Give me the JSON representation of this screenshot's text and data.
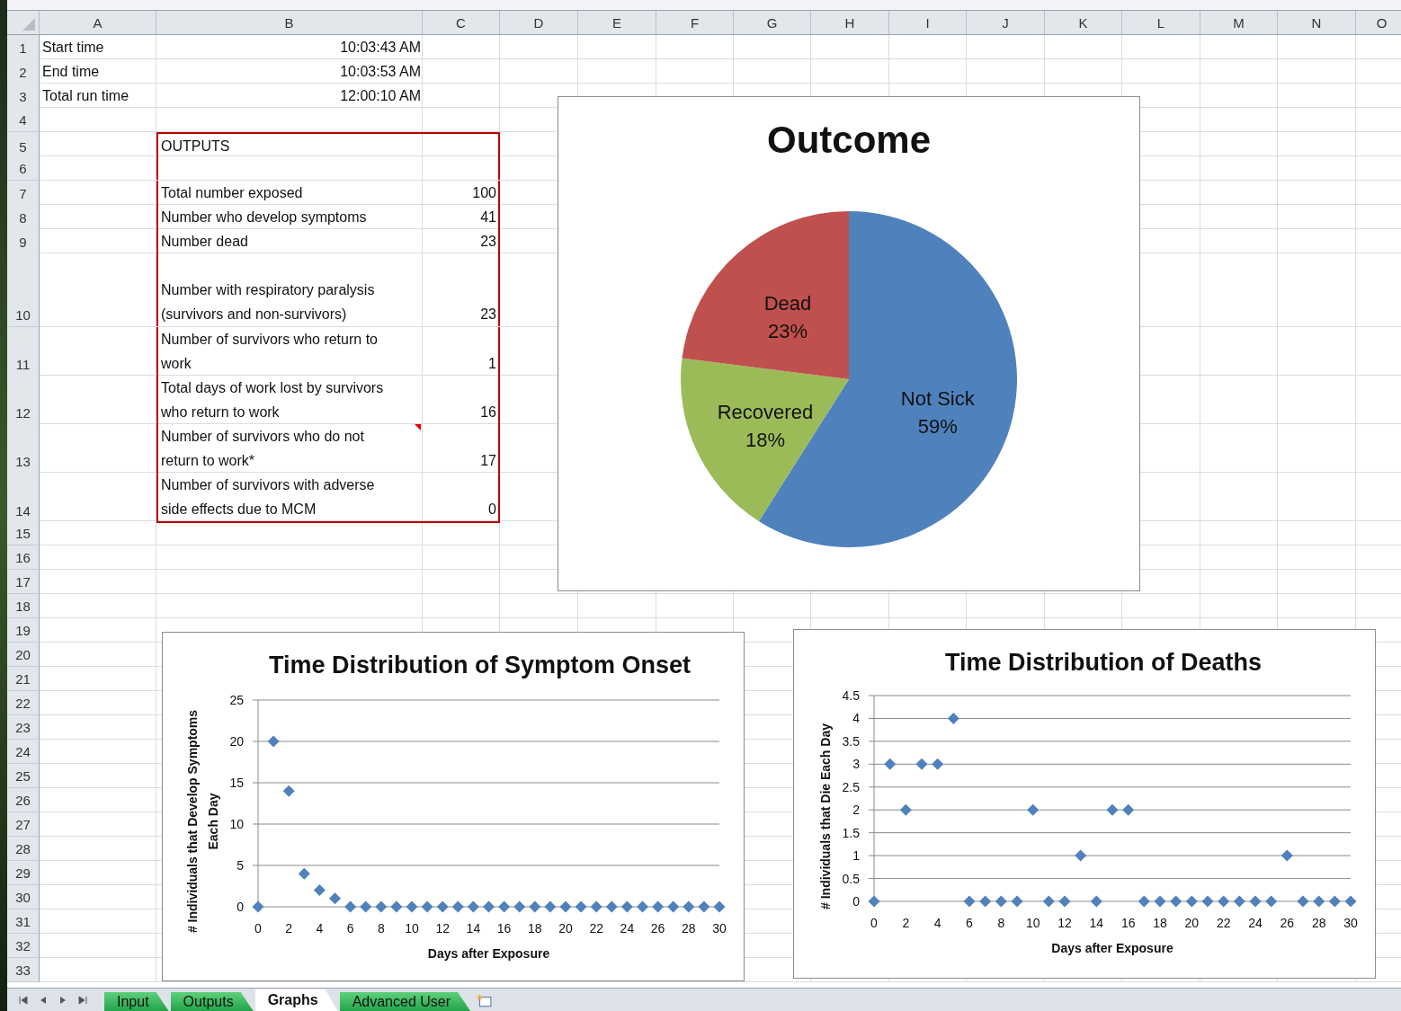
{
  "columns": [
    "A",
    "B",
    "C",
    "D",
    "E",
    "F",
    "G",
    "H",
    "I",
    "J",
    "K",
    "L",
    "M",
    "N",
    "O"
  ],
  "rows": [
    {
      "header": "1",
      "kind": "timing",
      "a": "Start time",
      "b": "10:03:43 AM",
      "boxed": false,
      "comment": false
    },
    {
      "header": "2",
      "kind": "timing",
      "a": "End time",
      "b": "10:03:53 AM",
      "boxed": false,
      "comment": false
    },
    {
      "header": "3",
      "kind": "timing",
      "a": "Total run time",
      "b": "12:00:10 AM",
      "boxed": false,
      "comment": false
    },
    {
      "header": "4",
      "kind": "blank",
      "boxed": false,
      "comment": false
    },
    {
      "header": "5",
      "kind": "output",
      "b": "OUTPUTS",
      "boxed": true,
      "comment": false
    },
    {
      "header": "6",
      "kind": "output",
      "boxed": true,
      "comment": false
    },
    {
      "header": "7",
      "kind": "output",
      "b": "Total number exposed",
      "c": "100",
      "boxed": true,
      "comment": false
    },
    {
      "header": "8",
      "kind": "output",
      "b": "Number who develop symptoms",
      "c": "41",
      "boxed": true,
      "comment": false
    },
    {
      "header": "9",
      "kind": "output",
      "b": "Number dead",
      "c": "23",
      "boxed": true,
      "comment": false
    },
    {
      "header": "10",
      "kind": "output",
      "b": "Number with respiratory paralysis (survivors and non-survivors)",
      "c": "23",
      "boxed": true,
      "comment": false
    },
    {
      "header": "11",
      "kind": "output",
      "b": "Number of survivors who return to work",
      "c": "1",
      "boxed": true,
      "comment": false
    },
    {
      "header": "12",
      "kind": "output",
      "b": "Total days of work lost by survivors who return to work",
      "c": "16",
      "boxed": true,
      "comment": false
    },
    {
      "header": "13",
      "kind": "output",
      "b": "Number of survivors who do not return to work*",
      "c": "17",
      "boxed": true,
      "comment": true
    },
    {
      "header": "14",
      "kind": "output",
      "b": "Number of survivors with adverse side effects due to MCM",
      "c": "0",
      "boxed": true,
      "comment": false
    },
    {
      "header": "15",
      "kind": "blank",
      "boxed": false,
      "comment": false
    },
    {
      "header": "16",
      "kind": "blank",
      "boxed": false,
      "comment": false
    },
    {
      "header": "17",
      "kind": "blank",
      "boxed": false,
      "comment": false
    },
    {
      "header": "18",
      "kind": "blank",
      "boxed": false,
      "comment": false
    },
    {
      "header": "19",
      "kind": "blank",
      "boxed": false,
      "comment": false
    },
    {
      "header": "20",
      "kind": "blank",
      "boxed": false,
      "comment": false
    },
    {
      "header": "21",
      "kind": "blank",
      "boxed": false,
      "comment": false
    },
    {
      "header": "22",
      "kind": "blank",
      "boxed": false,
      "comment": false
    },
    {
      "header": "23",
      "kind": "blank",
      "boxed": false,
      "comment": false
    },
    {
      "header": "24",
      "kind": "blank",
      "boxed": false,
      "comment": false
    },
    {
      "header": "25",
      "kind": "blank",
      "boxed": false,
      "comment": false
    },
    {
      "header": "26",
      "kind": "blank",
      "boxed": false,
      "comment": false
    },
    {
      "header": "27",
      "kind": "blank",
      "boxed": false,
      "comment": false
    },
    {
      "header": "28",
      "kind": "blank",
      "boxed": false,
      "comment": false
    },
    {
      "header": "29",
      "kind": "blank",
      "boxed": false,
      "comment": false
    },
    {
      "header": "30",
      "kind": "blank",
      "boxed": false,
      "comment": false
    },
    {
      "header": "31",
      "kind": "blank",
      "boxed": false,
      "comment": false
    },
    {
      "header": "32",
      "kind": "blank",
      "boxed": false,
      "comment": false
    },
    {
      "header": "33",
      "kind": "blank",
      "boxed": false,
      "comment": false
    }
  ],
  "charts": [
    {
      "chart_data": {
        "type": "pie",
        "title": "Outcome",
        "categories": [
          "Not Sick",
          "Recovered",
          "Dead"
        ],
        "values": [
          59,
          18,
          23
        ],
        "colors": [
          "#4f81bd",
          "#9bbb59",
          "#c0504d"
        ],
        "data_labels": true,
        "value_labels": [
          "59%",
          "18%",
          "23%"
        ]
      }
    },
    {
      "chart_data": {
        "type": "scatter",
        "title": "Time Distribution of Symptom Onset",
        "xlabel": "Days after Exposure",
        "ylabel": "# Individuals that Develop Symptoms Each Day",
        "x": [
          0,
          1,
          2,
          3,
          4,
          5,
          6,
          7,
          8,
          9,
          10,
          11,
          12,
          13,
          14,
          15,
          16,
          17,
          18,
          19,
          20,
          21,
          22,
          23,
          24,
          25,
          26,
          27,
          28,
          29,
          30
        ],
        "series": [
          {
            "color": "#4f81bd",
            "values": [
              0,
              20,
              14,
              4,
              2,
              1,
              0,
              0,
              0,
              0,
              0,
              0,
              0,
              0,
              0,
              0,
              0,
              0,
              0,
              0,
              0,
              0,
              0,
              0,
              0,
              0,
              0,
              0,
              0,
              0,
              0
            ]
          }
        ],
        "grid": true,
        "xlim": [
          0,
          30
        ],
        "ylim": [
          0,
          25
        ],
        "xticks": [
          0,
          2,
          4,
          6,
          8,
          10,
          12,
          14,
          16,
          18,
          20,
          22,
          24,
          26,
          28,
          30
        ],
        "yticks": [
          0,
          5,
          10,
          15,
          20,
          25
        ]
      }
    },
    {
      "chart_data": {
        "type": "scatter",
        "title": "Time Distribution of Deaths",
        "xlabel": "Days after Exposure",
        "ylabel": "# Individuals that Die Each Day",
        "x": [
          0,
          1,
          2,
          3,
          4,
          5,
          6,
          7,
          8,
          9,
          10,
          11,
          12,
          13,
          14,
          15,
          16,
          17,
          18,
          19,
          20,
          21,
          22,
          23,
          24,
          25,
          26,
          27,
          28,
          29,
          30
        ],
        "series": [
          {
            "color": "#4f81bd",
            "values": [
              0,
              3,
              2,
              3,
              3,
              4,
              0,
              0,
              0,
              0,
              2,
              0,
              0,
              1,
              0,
              2,
              2,
              0,
              0,
              0,
              0,
              0,
              0,
              0,
              0,
              0,
              1,
              0,
              0,
              0,
              0
            ]
          }
        ],
        "grid": true,
        "xlim": [
          0,
          30
        ],
        "ylim": [
          0,
          4.5
        ],
        "xticks": [
          0,
          2,
          4,
          6,
          8,
          10,
          12,
          14,
          16,
          18,
          20,
          22,
          24,
          26,
          28,
          30
        ],
        "yticks": [
          0,
          0.5,
          1,
          1.5,
          2,
          2.5,
          3,
          3.5,
          4,
          4.5
        ]
      }
    }
  ],
  "sheet_tabs": [
    {
      "label": "Input",
      "selected": false
    },
    {
      "label": "Outputs",
      "selected": false
    },
    {
      "label": "Graphs",
      "selected": true
    },
    {
      "label": "Advanced User",
      "selected": false
    }
  ]
}
